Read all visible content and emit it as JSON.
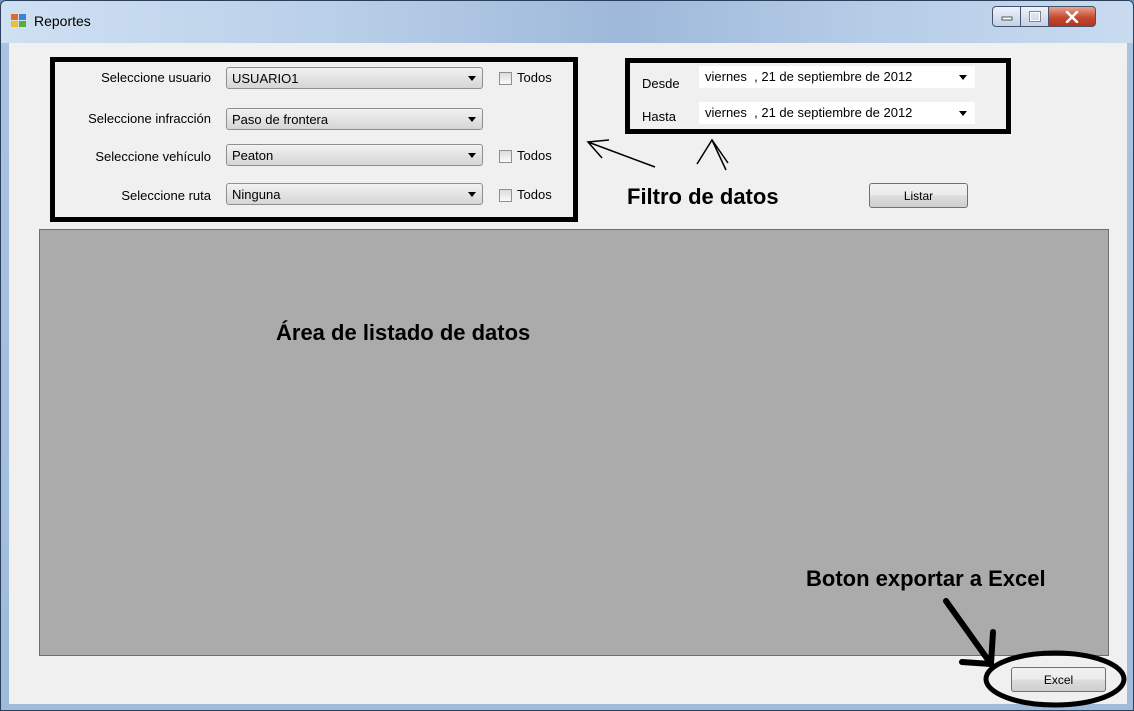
{
  "window": {
    "title": "Reportes"
  },
  "filters": {
    "usuario": {
      "label": "Seleccione usuario",
      "value": "USUARIO1",
      "todos_label": "Todos",
      "todos_checked": false
    },
    "infraccion": {
      "label": "Seleccione infracción",
      "value": "Paso de frontera"
    },
    "vehiculo": {
      "label": "Seleccione vehículo",
      "value": "Peaton",
      "todos_label": "Todos",
      "todos_checked": false
    },
    "ruta": {
      "label": "Seleccione ruta",
      "value": "Ninguna",
      "todos_label": "Todos",
      "todos_checked": false
    }
  },
  "dates": {
    "desde": {
      "label": "Desde",
      "value": "viernes  , 21 de septiembre de 2012"
    },
    "hasta": {
      "label": "Hasta",
      "value": "viernes  , 21 de septiembre de 2012"
    }
  },
  "buttons": {
    "listar": "Listar",
    "excel": "Excel"
  },
  "annotations": {
    "filtro": "Filtro de datos",
    "area": "Área de listado de datos",
    "excel": "Boton exportar a Excel"
  }
}
